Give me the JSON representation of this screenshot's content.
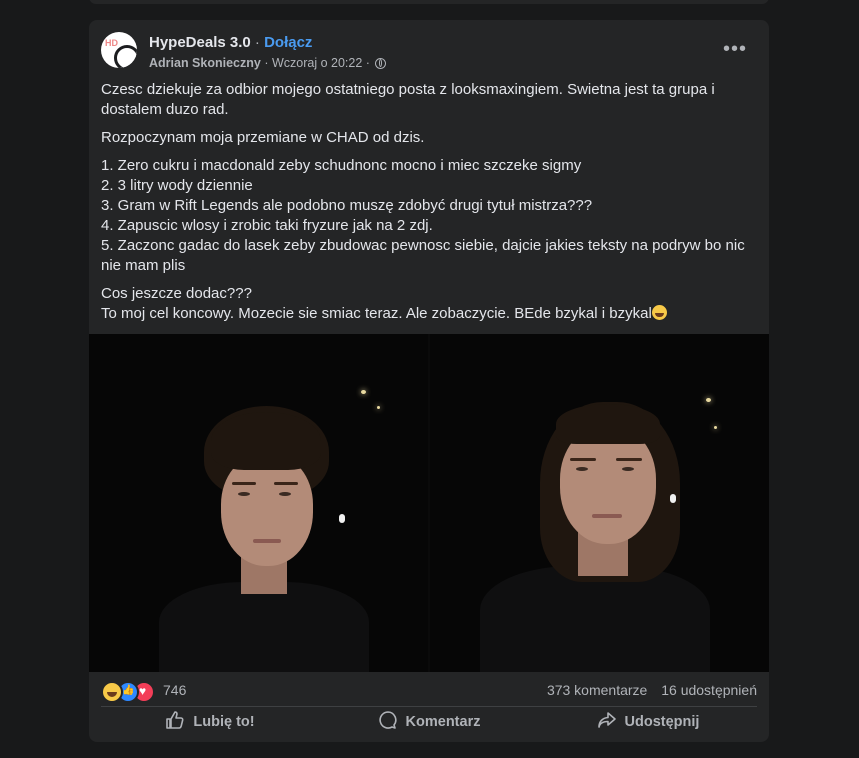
{
  "post": {
    "group_name": "HypeDeals 3.0",
    "separator": "·",
    "join_label": "Dołącz",
    "author": "Adrian Skonieczny",
    "time": "Wczoraj o 20:22",
    "time_sep": "·",
    "privacy_icon": "globe-icon",
    "more_icon": "more-options-icon",
    "more_label": "•••",
    "paragraph1": "Czesc dziekuje za odbior mojego ostatniego posta z looksmaxingiem. Swietna jest ta grupa i dostalem duzo rad.",
    "paragraph2": "Rozpoczynam moja przemiane w CHAD od dzis.",
    "list": [
      "1. Zero cukru i macdonald zeby schudnonc mocno i miec szczeke sigmy",
      "2. 3 litry wody dziennie",
      "3. Gram w Rift Legends ale podobno muszę zdobyć drugi tytuł mistrza???",
      "4. Zapuscic wlosy i zrobic taki fryzure jak na 2 zdj.",
      "5. Zaczonc gadac do lasek zeby zbudowac pewnosc siebie, dajcie jakies teksty na podryw bo nic nie mam plis"
    ],
    "closing1": "Cos jeszcze dodac???",
    "closing2": "To moj cel koncowy. Mozecie sie smiac teraz. Ale zobaczycie. BEde bzykal i bzykal"
  },
  "stats": {
    "reaction_count": "746",
    "comments": "373 komentarze",
    "shares": "16 udostępnień"
  },
  "actions": {
    "like": "Lubię to!",
    "comment": "Komentarz",
    "share": "Udostępnij"
  }
}
